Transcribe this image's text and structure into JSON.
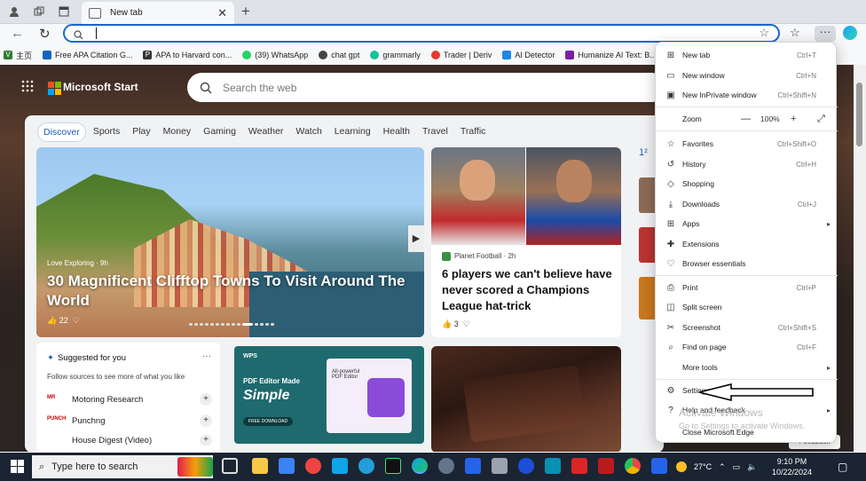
{
  "tab": {
    "title": "New tab"
  },
  "address": {
    "value": ""
  },
  "bookmarks": [
    {
      "label": "主页",
      "color": "#2e7d32"
    },
    {
      "label": "Free APA Citation G...",
      "color": "#1565c0"
    },
    {
      "label": "APA to Harvard con...",
      "color": "#333333"
    },
    {
      "label": "(39) WhatsApp",
      "color": "#25d366"
    },
    {
      "label": "chat gpt",
      "color": "#444444"
    },
    {
      "label": "grammarly",
      "color": "#15c39a"
    },
    {
      "label": "Trader | Deriv",
      "color": "#e53935"
    },
    {
      "label": "AI Detector",
      "color": "#1e88e5"
    },
    {
      "label": "Humanize AI Text: B...",
      "color": "#7b1fa2"
    }
  ],
  "msn": {
    "brand": "Microsoft Start",
    "search_placeholder": "Search the web",
    "categories": [
      "Discover",
      "Sports",
      "Play",
      "Money",
      "Gaming",
      "Weather",
      "Watch",
      "Learning",
      "Health",
      "Travel",
      "Traffic"
    ]
  },
  "hero": {
    "source": "Love Exploring · 9h",
    "title": "30 Magnificent Clifftop Towns To Visit Around The World",
    "likes": "22"
  },
  "football": {
    "source": "Planet Football · 2h",
    "title": "6 players we can't believe have never scored a Champions League hat-trick",
    "likes": "3"
  },
  "suggested": {
    "heading": "Suggested for you",
    "subheading": "Follow sources to see more of what you like",
    "items": [
      "Motoring Research",
      "Punchng",
      "House Digest (Video)"
    ]
  },
  "wps": {
    "logo": "WPS",
    "line1": "PDF Editor Made",
    "line2": "Simple",
    "button": "FREE DOWNLOAD",
    "mock_text": "All-powerful PDF Editor"
  },
  "menu": {
    "items": [
      {
        "label": "New tab",
        "shortcut": "Ctrl+T",
        "icon": "new-tab-icon"
      },
      {
        "label": "New window",
        "shortcut": "Ctrl+N",
        "icon": "new-window-icon"
      },
      {
        "label": "New InPrivate window",
        "shortcut": "Ctrl+Shift+N",
        "icon": "inprivate-icon"
      },
      {
        "label": "Favorites",
        "shortcut": "Ctrl+Shift+O",
        "icon": "favorites-icon"
      },
      {
        "label": "History",
        "shortcut": "Ctrl+H",
        "icon": "history-icon"
      },
      {
        "label": "Shopping",
        "shortcut": "",
        "icon": "shopping-icon"
      },
      {
        "label": "Downloads",
        "shortcut": "Ctrl+J",
        "icon": "downloads-icon"
      },
      {
        "label": "Apps",
        "shortcut": "",
        "icon": "apps-icon"
      },
      {
        "label": "Extensions",
        "shortcut": "",
        "icon": "extensions-icon"
      },
      {
        "label": "Browser essentials",
        "shortcut": "",
        "icon": "browser-essentials-icon"
      },
      {
        "label": "Print",
        "shortcut": "Ctrl+P",
        "icon": "print-icon"
      },
      {
        "label": "Split screen",
        "shortcut": "",
        "icon": "split-screen-icon"
      },
      {
        "label": "Screenshot",
        "shortcut": "Ctrl+Shift+S",
        "icon": "screenshot-icon"
      },
      {
        "label": "Find on page",
        "shortcut": "Ctrl+F",
        "icon": "find-icon"
      },
      {
        "label": "More tools",
        "shortcut": "",
        "icon": ""
      },
      {
        "label": "Settings",
        "shortcut": "",
        "icon": "settings-icon"
      },
      {
        "label": "Help and feedback",
        "shortcut": "",
        "icon": "help-icon"
      },
      {
        "label": "Close Microsoft Edge",
        "shortcut": "",
        "icon": ""
      }
    ],
    "zoom_label": "Zoom",
    "zoom_value": "100%"
  },
  "watermark": {
    "line1": "Activate Windows",
    "line2": "Go to Settings to activate Windows."
  },
  "feedback": "Feedback",
  "taskbar": {
    "search_placeholder": "Type here to search",
    "temperature": "27°C",
    "time": "9:10 PM",
    "date": "10/22/2024"
  }
}
